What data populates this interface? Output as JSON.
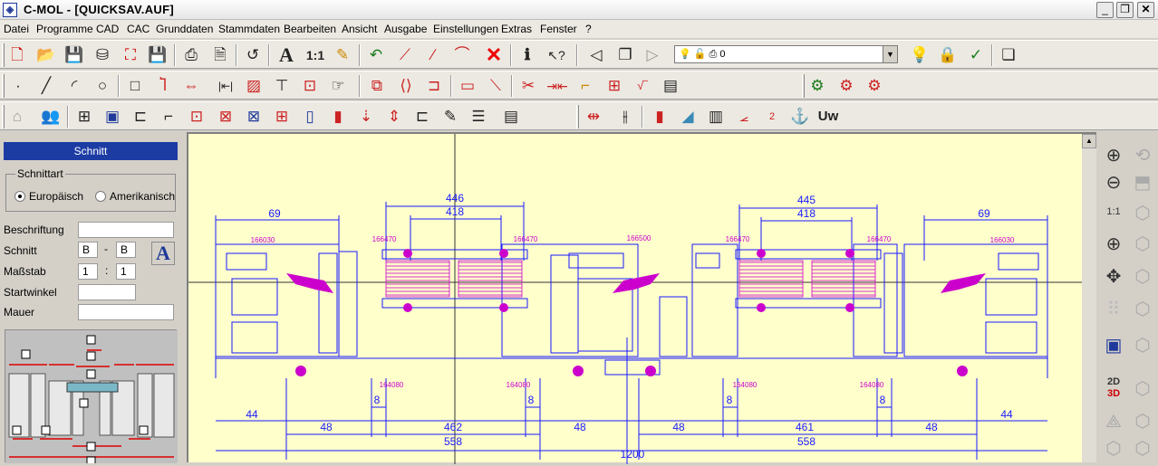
{
  "window": {
    "title": "C-MOL - [QUICKSAV.AUF]",
    "icon": "cmol-app-icon"
  },
  "menu": [
    "Datei",
    "Programme",
    "CAD",
    "CAC",
    "Grunddaten",
    "Stammdaten",
    "Bearbeiten",
    "Ansicht",
    "Ausgabe",
    "Einstellungen",
    "Extras",
    "Fenster",
    "?"
  ],
  "toolbar": {
    "scale_label": "1:1",
    "text_tool_label": "A",
    "layer_value": "0",
    "uw_label": "Uw",
    "num_tool_label": "2"
  },
  "panel": {
    "title": "Schnitt",
    "schnittart_label": "Schnittart",
    "radio_europaeisch": "Europäisch",
    "radio_amerikanisch": "Amerikanisch",
    "beschriftung_label": "Beschriftung",
    "beschriftung_value": "",
    "schnitt_label": "Schnitt",
    "schnitt_from": "B",
    "schnitt_sep": "-",
    "schnitt_to": "B",
    "massstab_label": "Maßstab",
    "massstab_a": "1",
    "massstab_sep": ":",
    "massstab_b": "1",
    "startwinkel_label": "Startwinkel",
    "startwinkel_value": "",
    "mauer_label": "Mauer",
    "mauer_value": "",
    "style_button_label": "A"
  },
  "drawing": {
    "dims_top": [
      "446",
      "418",
      "445",
      "418",
      "69",
      "69"
    ],
    "profile_labels": [
      "166030",
      "166470",
      "166470",
      "166500",
      "166470",
      "166470",
      "166030"
    ],
    "bottom_labels": [
      "164080",
      "164080",
      "164080",
      "164080"
    ],
    "dims_small": [
      "8",
      "8",
      "8",
      "8"
    ],
    "dims_row1": [
      "44",
      "48",
      "462",
      "48",
      "48",
      "461",
      "48",
      "44"
    ],
    "dims_row2": [
      "558",
      "558"
    ],
    "dim_total": "1200"
  },
  "righttools": {
    "view_2d3d_label_2d": "2D",
    "view_2d3d_label_3d": "3D",
    "zoom_fit_label": "1:1"
  },
  "colors": {
    "panel_title_bg": "#1c3ca4",
    "canvas_bg": "#ffffcc",
    "dim_blue": "#1a1aff",
    "profile_magenta": "#cc00cc"
  }
}
